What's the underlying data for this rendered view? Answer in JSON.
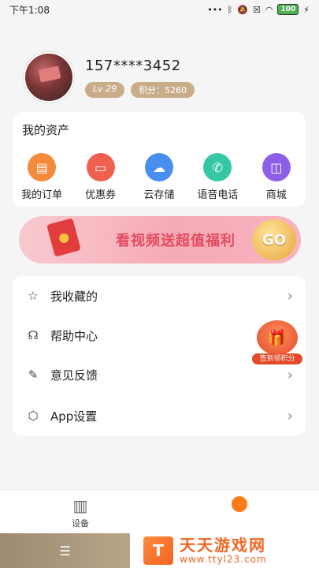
{
  "status": {
    "time": "下午1:08",
    "icons": [
      "more-dots-icon",
      "bluetooth-icon",
      "mute-icon",
      "close-box-icon",
      "wifi-icon"
    ],
    "battery": "100",
    "charging": "⚡"
  },
  "profile": {
    "phone": "157****3452",
    "level": "Lv 29",
    "points": "积分：5260"
  },
  "assets": {
    "title": "我的资产",
    "items": [
      {
        "label": "我的订单",
        "icon": "orders-icon",
        "color": "#f58a3a"
      },
      {
        "label": "优惠券",
        "icon": "coupon-icon",
        "color": "#f0604e"
      },
      {
        "label": "云存储",
        "icon": "cloud-icon",
        "color": "#4a8ef0"
      },
      {
        "label": "语音电话",
        "icon": "phone-icon",
        "color": "#36c7a6"
      },
      {
        "label": "商城",
        "icon": "shop-icon",
        "color": "#8e5ee8"
      }
    ]
  },
  "banner": {
    "text": "看视频送超值福利",
    "go": "GO"
  },
  "menu": {
    "items": [
      {
        "label": "我收藏的",
        "icon": "star-icon"
      },
      {
        "label": "帮助中心",
        "icon": "headset-icon"
      },
      {
        "label": "意见反馈",
        "icon": "feedback-icon"
      },
      {
        "label": "App设置",
        "icon": "settings-icon"
      }
    ]
  },
  "gift": {
    "tag": "签到领积分"
  },
  "tabbar": {
    "device_label": "设备"
  },
  "navbar": {
    "home": "☰"
  },
  "watermark": {
    "title": "天天游戏网",
    "url": "www.ttyl23.com",
    "logo": "T"
  }
}
